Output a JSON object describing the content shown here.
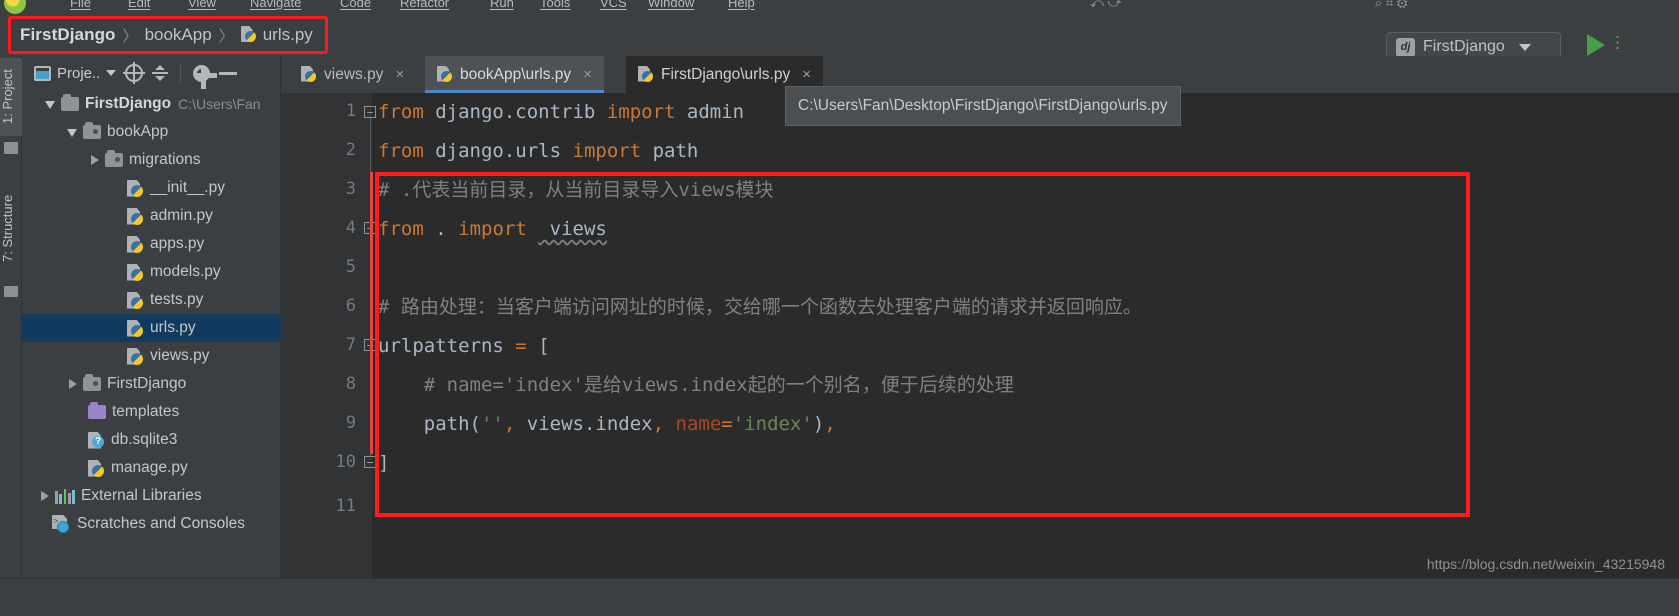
{
  "window": {
    "menu_items": [
      "File",
      "Edit",
      "View",
      "Navigate",
      "Code",
      "Refactor",
      "Run",
      "Tools",
      "VCS",
      "Window",
      "Help"
    ]
  },
  "breadcrumb": {
    "separator": "〉",
    "items": [
      {
        "label": "FirstDjango",
        "bold": true,
        "icon": ""
      },
      {
        "label": "bookApp",
        "bold": false,
        "icon": ""
      },
      {
        "label": "urls.py",
        "bold": false,
        "icon": "python-file-icon"
      }
    ]
  },
  "run_config": {
    "badge": "dj",
    "name": "FirstDjango",
    "dropdown_icon": "chevron-down-icon",
    "run_icon": "run-play-icon",
    "debug_icon": "debug-icon"
  },
  "tool_strip": {
    "tabs": [
      {
        "label": "1: Project",
        "selected": true
      },
      {
        "label": "7: Structure",
        "selected": false
      }
    ]
  },
  "project_panel": {
    "toolbar": {
      "view_label": "Proje..",
      "view_caret": "chevron-down-icon",
      "locate_icon": "target-icon",
      "collapse_icon": "collapse-all-icon",
      "settings_icon": "gear-icon",
      "hide_icon": "minimize-icon"
    },
    "tree": [
      {
        "depth": 0,
        "twig": "down",
        "icon": "folder",
        "label": "FirstDjango",
        "bold": true,
        "note": "C:\\Users\\Fan",
        "selected": false
      },
      {
        "depth": 1,
        "twig": "down",
        "icon": "module-folder",
        "label": "bookApp",
        "bold": false,
        "note": "",
        "selected": false
      },
      {
        "depth": 2,
        "twig": "right",
        "icon": "module-folder",
        "label": "migrations",
        "bold": false,
        "note": "",
        "selected": false
      },
      {
        "depth": 3,
        "twig": "none",
        "icon": "python-file",
        "label": "__init__.py",
        "bold": false,
        "note": "",
        "selected": false
      },
      {
        "depth": 3,
        "twig": "none",
        "icon": "python-file",
        "label": "admin.py",
        "bold": false,
        "note": "",
        "selected": false
      },
      {
        "depth": 3,
        "twig": "none",
        "icon": "python-file",
        "label": "apps.py",
        "bold": false,
        "note": "",
        "selected": false
      },
      {
        "depth": 3,
        "twig": "none",
        "icon": "python-file",
        "label": "models.py",
        "bold": false,
        "note": "",
        "selected": false
      },
      {
        "depth": 3,
        "twig": "none",
        "icon": "python-file",
        "label": "tests.py",
        "bold": false,
        "note": "",
        "selected": false
      },
      {
        "depth": 3,
        "twig": "none",
        "icon": "python-file",
        "label": "urls.py",
        "bold": false,
        "note": "",
        "selected": true
      },
      {
        "depth": 3,
        "twig": "none",
        "icon": "python-file",
        "label": "views.py",
        "bold": false,
        "note": "",
        "selected": false
      },
      {
        "depth": 2,
        "twig": "right",
        "icon": "module-folder",
        "label": "FirstDjango",
        "bold": false,
        "note": "",
        "selected": false
      },
      {
        "depth": 2,
        "twig": "none",
        "icon": "folder-purple",
        "label": "templates",
        "bold": false,
        "note": "",
        "selected": false
      },
      {
        "depth": 2,
        "twig": "none",
        "icon": "db-file",
        "label": "db.sqlite3",
        "bold": false,
        "note": "",
        "selected": false
      },
      {
        "depth": 2,
        "twig": "none",
        "icon": "python-file",
        "label": "manage.py",
        "bold": false,
        "note": "",
        "selected": false
      },
      {
        "depth": 0,
        "twig": "right",
        "icon": "library",
        "label": "External Libraries",
        "bold": false,
        "note": "",
        "selected": false
      },
      {
        "depth": 1,
        "twig": "none",
        "icon": "scratches",
        "label": "Scratches and Consoles",
        "bold": false,
        "note": "",
        "selected": false
      }
    ]
  },
  "editor": {
    "tabs": [
      {
        "label": "views.py",
        "icon": "python-file-icon",
        "state": "inactive",
        "close": "×"
      },
      {
        "label": "bookApp\\urls.py",
        "icon": "python-file-icon",
        "state": "active",
        "close": "×"
      },
      {
        "label": "FirstDjango\\urls.py",
        "icon": "python-file-icon",
        "state": "current",
        "close": "×"
      }
    ],
    "tooltip": "C:\\Users\\Fan\\Desktop\\FirstDjango\\FirstDjango\\urls.py",
    "line_numbers": [
      "1",
      "2",
      "3",
      "4",
      "5",
      "6",
      "7",
      "8",
      "9",
      "10",
      "11"
    ],
    "lines": [
      {
        "n": 1,
        "text": "from django.contrib import admin"
      },
      {
        "n": 2,
        "text": "from django.urls import path"
      },
      {
        "n": 3,
        "text": "# .代表当前目录，从当前目录导入views模块"
      },
      {
        "n": 4,
        "text": "from . import  views"
      },
      {
        "n": 5,
        "text": ""
      },
      {
        "n": 6,
        "text": "# 路由处理：当客户端访问网址的时候，交给哪一个函数去处理客户端的请求并返回响应。"
      },
      {
        "n": 7,
        "text": "urlpatterns = ["
      },
      {
        "n": 8,
        "text": "    # name='index'是给views.index起的一个别名，便于后续的处理"
      },
      {
        "n": 9,
        "text": "    path('', views.index, name='index'),"
      },
      {
        "n": 10,
        "text": "]"
      },
      {
        "n": 11,
        "text": ""
      }
    ]
  },
  "watermark": "https://blog.csdn.net/weixin_43215948",
  "colors": {
    "panel_bg": "#3c3f41",
    "editor_bg": "#2b2b2b",
    "gutter_bg": "#313335",
    "selection": "#123a5e",
    "highlight_red": "#fe1c1c",
    "keyword": "#cc7832",
    "string": "#6a8759",
    "comment": "#808080",
    "identifier": "#a9b7c6",
    "named_arg": "#aa4926",
    "accent_blue": "#4a88c7",
    "run_green": "#46a04b"
  }
}
